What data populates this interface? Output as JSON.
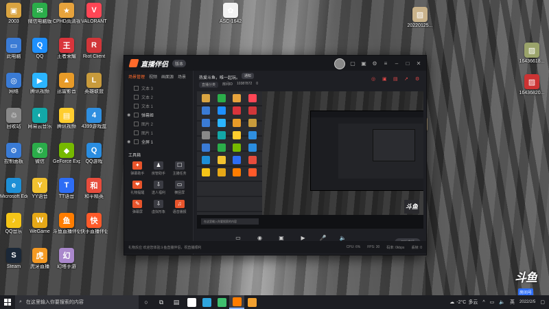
{
  "desktop": {
    "icons_left": [
      {
        "label": "2003",
        "color": "#d9a441",
        "glyph": "▣"
      },
      {
        "label": "此电脑",
        "color": "#3a7bd5",
        "glyph": "▭"
      },
      {
        "label": "网络",
        "color": "#3a7bd5",
        "glyph": "◎"
      },
      {
        "label": "回收站",
        "color": "#888888",
        "glyph": "♲"
      },
      {
        "label": "控制面板",
        "color": "#3a7bd5",
        "glyph": "⚙"
      },
      {
        "label": "Microsoft Edge",
        "color": "#1e8fd6",
        "glyph": "e"
      },
      {
        "label": "QQ音乐",
        "color": "#f5c518",
        "glyph": "♪"
      },
      {
        "label": "Steam",
        "color": "#1b2838",
        "glyph": "S"
      }
    ],
    "icons_col2": [
      {
        "label": "微信电脑版",
        "color": "#2bad4a",
        "glyph": "✉"
      },
      {
        "label": "QQ",
        "color": "#1e90ff",
        "glyph": "Q"
      },
      {
        "label": "腾讯视频",
        "color": "#2bb5ff",
        "glyph": "▶"
      },
      {
        "label": "网易云音乐",
        "color": "#13a8a8",
        "glyph": "◐"
      },
      {
        "label": "微信",
        "color": "#2bad4a",
        "glyph": "✆"
      },
      {
        "label": "YY语音",
        "color": "#f2c230",
        "glyph": "Y"
      },
      {
        "label": "WeGame",
        "color": "#e6a817",
        "glyph": "W"
      },
      {
        "label": "虎牙直播",
        "color": "#f59a23",
        "glyph": "虎"
      }
    ],
    "icons_col3": [
      {
        "label": "CPHD高清视频大全",
        "color": "#e7a33c",
        "glyph": "★"
      },
      {
        "label": "王者荣耀",
        "color": "#d9343b",
        "glyph": "王"
      },
      {
        "label": "迅雷影音",
        "color": "#e89b28",
        "glyph": "▲"
      },
      {
        "label": "腾讯视频",
        "color": "#ffcd2e",
        "glyph": "▤"
      },
      {
        "label": "GeForce Experience",
        "color": "#76b900",
        "glyph": "◆"
      },
      {
        "label": "TT语音",
        "color": "#2d6df5",
        "glyph": "T"
      },
      {
        "label": "斗鱼直播伴侣",
        "color": "#ff7d00",
        "glyph": "鱼"
      },
      {
        "label": "幻塔手游",
        "color": "#aa88cc",
        "glyph": "幻"
      }
    ],
    "icons_col4": [
      {
        "label": "VALORANT",
        "color": "#ff4655",
        "glyph": "V"
      },
      {
        "label": "Riot Client",
        "color": "#d13639",
        "glyph": "R"
      },
      {
        "label": "英雄联盟",
        "color": "#c89b3c",
        "glyph": "L"
      },
      {
        "label": "4399游戏盒",
        "color": "#2f8fe0",
        "glyph": "4"
      },
      {
        "label": "QQ游戏",
        "color": "#2a8de0",
        "glyph": "Q"
      },
      {
        "label": "和平精英",
        "color": "#e74c3c",
        "glyph": "和"
      },
      {
        "label": "快手直播伴侣",
        "color": "#ff5a2a",
        "glyph": "快"
      }
    ],
    "icons_mid": [
      {
        "label": "ASC-1642",
        "color": "#f2f2f2",
        "glyph": "✿"
      }
    ],
    "icons_right": [
      {
        "label": "20220125...",
        "color": "#c9b28a",
        "glyph": "▨"
      },
      {
        "label": "16436618...",
        "color": "#9aa36a",
        "glyph": "▨"
      },
      {
        "label": "16436820...",
        "color": "#cc3333",
        "glyph": "▨"
      },
      {
        "label": "",
        "color": "#c9b28a",
        "glyph": "▨"
      }
    ]
  },
  "app": {
    "title": "直播伴侣",
    "version_badge": "版本",
    "sidebar_tabs": [
      "场景管理",
      "视频",
      "画面源",
      "场景"
    ],
    "scenes": [
      {
        "label": "文本 3",
        "visible": false
      },
      {
        "label": "文本 2",
        "visible": false
      },
      {
        "label": "文本 1",
        "visible": false
      },
      {
        "label": "弹幕姬",
        "visible": true
      },
      {
        "label": "图片 2",
        "visible": false
      },
      {
        "label": "图片 1",
        "visible": false
      },
      {
        "label": "全屏 1",
        "visible": true
      }
    ],
    "tools_title": "工具箱",
    "tools": [
      {
        "label": "弹幕助手",
        "color": "#e8542b",
        "glyph": "✦"
      },
      {
        "label": "房管助手",
        "color": "#3a3b42",
        "glyph": "♟"
      },
      {
        "label": "主播任务",
        "color": "#3a3b42",
        "glyph": "☐"
      },
      {
        "label": "礼物提醒",
        "color": "#e8542b",
        "glyph": "❤"
      },
      {
        "label": "送人福利",
        "color": "#3a3b42",
        "glyph": "⇩"
      },
      {
        "label": "横竖屏",
        "color": "#3a3b42",
        "glyph": "▭"
      },
      {
        "label": "弹幕屏",
        "color": "#e8542b",
        "glyph": "✎"
      },
      {
        "label": "虚拟形象",
        "color": "#3a3b42",
        "glyph": "⇩"
      },
      {
        "label": "语音播报",
        "color": "#e8542b",
        "glyph": "♫"
      }
    ],
    "notice_text": "热爱斗鱼，唯一起玩。",
    "notice_button": "通知",
    "room_pill": "直播分类",
    "room_label": "房间ID",
    "room_id": "10387872",
    "room_count": "0",
    "bottom_controls": [
      {
        "label": "直播屏幕",
        "glyph": "▭"
      },
      {
        "label": "摄像头",
        "glyph": "◉"
      },
      {
        "label": "手机投屏",
        "glyph": "▣"
      },
      {
        "label": "多媒体",
        "glyph": "▶"
      },
      {
        "label": "麦克风",
        "glyph": "🎤"
      },
      {
        "label": "扬声器",
        "glyph": "🔈"
      }
    ],
    "start_button": "开始直播",
    "status_left": "礼物反应   欢迎您体验斗鱼直播伴侣，祝直播顺利",
    "status_right": [
      "CPU: 6%",
      "FPS: 30",
      "码率: 0kbps",
      "丢帧: 0"
    ],
    "preview_search": "在这里输入你要搜索的内容",
    "preview_badge": "斗鱼"
  },
  "watermark": {
    "logo": "斗鱼",
    "sub": "房间号",
    "room": "10387872"
  },
  "taskbar": {
    "search_placeholder": "在这里输入你要搜索的内容",
    "weather_temp": "-2°C",
    "weather_desc": "多云",
    "time": "",
    "date": "2022/2/5",
    "pinned": [
      {
        "name": "task-view",
        "color": "#ffffff"
      },
      {
        "name": "edge-like",
        "color": "#2fa5dd"
      },
      {
        "name": "green-app",
        "color": "#3fbf6e"
      },
      {
        "name": "douyu-app",
        "color": "#ff7d00"
      },
      {
        "name": "doc-app",
        "color": "#f0a030"
      }
    ]
  }
}
